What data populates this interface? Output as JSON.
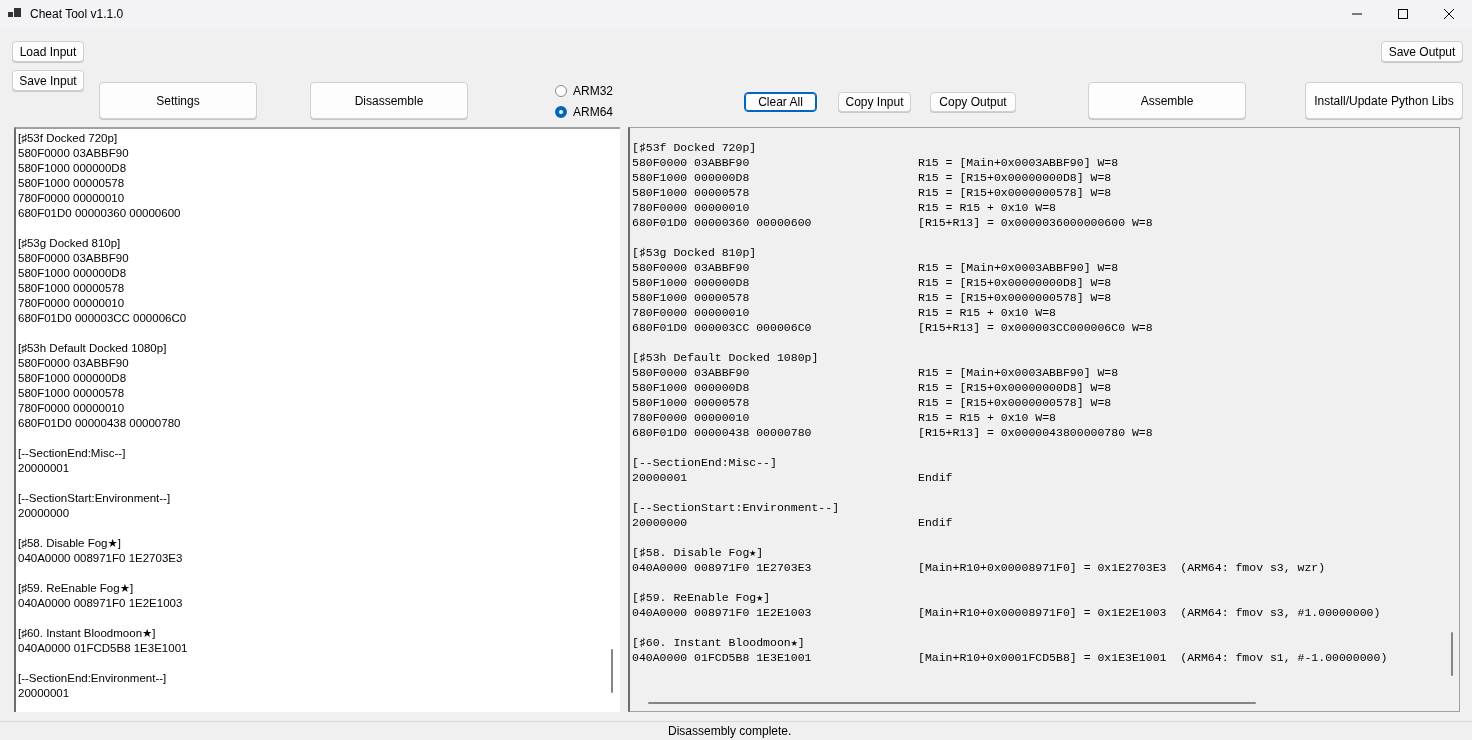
{
  "window": {
    "title": "Cheat Tool v1.1.0"
  },
  "toolbar": {
    "load_input": {
      "label": "Load Input",
      "focused": false
    },
    "save_input": {
      "label": "Save Input",
      "focused": false
    },
    "settings": {
      "label": "Settings",
      "focused": false
    },
    "disassemble": {
      "label": "Disassemble",
      "focused": false
    },
    "arch_options": [
      {
        "label": "ARM32",
        "selected": false
      },
      {
        "label": "ARM64",
        "selected": true
      }
    ],
    "clear_all": {
      "label": "Clear All",
      "focused": true
    },
    "copy_input": {
      "label": "Copy Input",
      "focused": false
    },
    "copy_output": {
      "label": "Copy Output",
      "focused": false
    },
    "assemble": {
      "label": "Assemble",
      "focused": false
    },
    "save_output": {
      "label": "Save Output",
      "focused": false
    },
    "install_libs": {
      "label": "Install/Update Python Libs",
      "focused": false
    }
  },
  "input_blocks": [
    {
      "lines": [
        "[♯53f Docked 720p]",
        "580F0000 03ABBF90",
        "580F1000 000000D8",
        "580F1000 00000578",
        "780F0000 00000010",
        "680F01D0 00000360 00000600"
      ]
    },
    {
      "lines": [
        "[♯53g Docked 810p]",
        "580F0000 03ABBF90",
        "580F1000 000000D8",
        "580F1000 00000578",
        "780F0000 00000010",
        "680F01D0 000003CC 000006C0"
      ]
    },
    {
      "lines": [
        "[♯53h Default Docked 1080p]",
        "580F0000 03ABBF90",
        "580F1000 000000D8",
        "580F1000 00000578",
        "780F0000 00000010",
        "680F01D0 00000438 00000780"
      ]
    },
    {
      "lines": [
        "[--SectionEnd:Misc--]",
        "20000001"
      ]
    },
    {
      "lines": [
        "[--SectionStart:Environment--]",
        "20000000"
      ]
    },
    {
      "lines": [
        "[♯58. Disable Fog★]",
        "040A0000 008971F0 1E2703E3"
      ]
    },
    {
      "lines": [
        "[♯59. ReEnable Fog★]",
        "040A0000 008971F0 1E2E1003"
      ]
    },
    {
      "lines": [
        "[♯60. Instant Bloodmoon★]",
        "040A0000 01FCD5B8 1E3E1001"
      ]
    },
    {
      "lines": [
        "[--SectionEnd:Environment--]",
        "20000001"
      ]
    }
  ],
  "output_blocks": [
    {
      "lines": [
        {
          "code": "[♯53f Docked 720p]"
        },
        {
          "code": "580F0000 03ABBF90",
          "comment": "R15 = [Main+0x0003ABBF90] W=8"
        },
        {
          "code": "580F1000 000000D8",
          "comment": "R15 = [R15+0x00000000D8] W=8"
        },
        {
          "code": "580F1000 00000578",
          "comment": "R15 = [R15+0x0000000578] W=8"
        },
        {
          "code": "780F0000 00000010",
          "comment": "R15 = R15 + 0x10 W=8"
        },
        {
          "code": "680F01D0 00000360 00000600",
          "comment": "[R15+R13] = 0x0000036000000600 W=8"
        }
      ]
    },
    {
      "lines": [
        {
          "code": "[♯53g Docked 810p]"
        },
        {
          "code": "580F0000 03ABBF90",
          "comment": "R15 = [Main+0x0003ABBF90] W=8"
        },
        {
          "code": "580F1000 000000D8",
          "comment": "R15 = [R15+0x00000000D8] W=8"
        },
        {
          "code": "580F1000 00000578",
          "comment": "R15 = [R15+0x0000000578] W=8"
        },
        {
          "code": "780F0000 00000010",
          "comment": "R15 = R15 + 0x10 W=8"
        },
        {
          "code": "680F01D0 000003CC 000006C0",
          "comment": "[R15+R13] = 0x000003CC000006C0 W=8"
        }
      ]
    },
    {
      "lines": [
        {
          "code": "[♯53h Default Docked 1080p]"
        },
        {
          "code": "580F0000 03ABBF90",
          "comment": "R15 = [Main+0x0003ABBF90] W=8"
        },
        {
          "code": "580F1000 000000D8",
          "comment": "R15 = [R15+0x00000000D8] W=8"
        },
        {
          "code": "580F1000 00000578",
          "comment": "R15 = [R15+0x0000000578] W=8"
        },
        {
          "code": "780F0000 00000010",
          "comment": "R15 = R15 + 0x10 W=8"
        },
        {
          "code": "680F01D0 00000438 00000780",
          "comment": "[R15+R13] = 0x0000043800000780 W=8"
        }
      ]
    },
    {
      "lines": [
        {
          "code": "[--SectionEnd:Misc--]"
        },
        {
          "code": "20000001",
          "comment": "Endif"
        }
      ]
    },
    {
      "lines": [
        {
          "code": "[--SectionStart:Environment--]"
        },
        {
          "code": "20000000",
          "comment": "Endif"
        }
      ]
    },
    {
      "lines": [
        {
          "code": "[♯58. Disable Fog★]"
        },
        {
          "code": "040A0000 008971F0 1E2703E3",
          "comment": "[Main+R10+0x00008971F0] = 0x1E2703E3  (ARM64: fmov s3, wzr)"
        }
      ]
    },
    {
      "lines": [
        {
          "code": "[♯59. ReEnable Fog★]"
        },
        {
          "code": "040A0000 008971F0 1E2E1003",
          "comment": "[Main+R10+0x00008971F0] = 0x1E2E1003  (ARM64: fmov s3, #1.00000000)"
        }
      ]
    },
    {
      "lines": [
        {
          "code": "[♯60. Instant Bloodmoon★]"
        },
        {
          "code": "040A0000 01FCD5B8 1E3E1001",
          "comment": "[Main+R10+0x0001FCD5B8] = 0x1E3E1001  (ARM64: fmov s1, #-1.00000000)"
        }
      ]
    }
  ],
  "status_bar": "Disassembly complete."
}
